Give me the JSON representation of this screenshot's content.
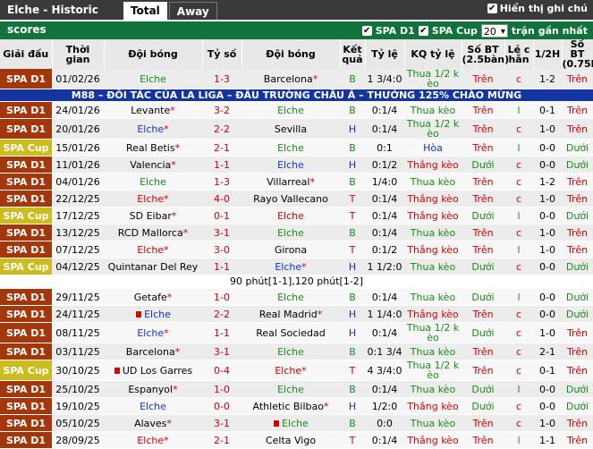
{
  "header": {
    "title": "Elche - Historic scores",
    "tabs": [
      "Total",
      "Away"
    ],
    "show_notes_label": "Hiển thị ghi chú"
  },
  "filters": {
    "spa_d1": "SPA D1",
    "spa_cup": "SPA Cup",
    "count": "20",
    "recent_label": "trận gần nhất"
  },
  "columns": [
    "Giải đấu",
    "Thời gian",
    "Đội bóng",
    "Tỷ số",
    "Đội bóng",
    "Kết quả",
    "Tỷ lệ",
    "KQ tỷ lệ",
    "Số BT (2.5bàn)",
    "Lẻ c hẵn",
    "1/2H",
    "Số BT (0.75bàn)"
  ],
  "ad_text": "M88 – ĐỐI TÁC CỦA LA LIGA – ĐẤU TRƯỜNG CHÂU Á – THƯỞNG 125% CHÀO MỪNG",
  "info_text": "90 phút[1-1],120 phút[1-2]",
  "rows": [
    {
      "league": "SPA D1",
      "date": "01/02/26",
      "home": "Elche",
      "home_star": "",
      "score": "1-3",
      "away": "Barcelona",
      "away_star": "*",
      "res": "B",
      "odds": "1 3/4:0",
      "kq": "Thua 1/2 k èo",
      "kqc": "lose",
      "ou": "Trên",
      "oe": "c",
      "ht": "1-2",
      "ou2": "Trên",
      "hc": "green",
      "ac": "black"
    },
    {
      "league": "SPA D1",
      "date": "24/01/26",
      "home": "Levante",
      "home_star": "*",
      "score": "3-2",
      "away": "Elche",
      "away_star": "",
      "res": "B",
      "odds": "0:1/4",
      "kq": "Thua kèo",
      "kqc": "lose",
      "ou": "Trên",
      "oe": "l",
      "ht": "0-1",
      "ou2": "Trên",
      "hc": "black",
      "ac": "green"
    },
    {
      "league": "SPA D1",
      "date": "20/01/26",
      "home": "Elche",
      "home_star": "*",
      "score": "2-2",
      "away": "Sevilla",
      "away_star": "",
      "res": "H",
      "odds": "0:1/4",
      "kq": "Thua 1/2 k èo",
      "kqc": "lose",
      "ou": "Trên",
      "oe": "c",
      "ht": "1-0",
      "ou2": "Trên",
      "hc": "blue",
      "ac": "black"
    },
    {
      "league": "SPA Cup",
      "date": "15/01/26",
      "home": "Real Betis",
      "home_star": "*",
      "score": "2-1",
      "away": "Elche",
      "away_star": "",
      "res": "B",
      "odds": "0:1",
      "kq": "Hòa",
      "kqc": "draw",
      "ou": "Trên",
      "oe": "l",
      "ht": "0-0",
      "ou2": "Dưới",
      "hc": "black",
      "ac": "green"
    },
    {
      "league": "SPA D1",
      "date": "11/01/26",
      "home": "Valencia",
      "home_star": "*",
      "score": "1-1",
      "away": "Elche",
      "away_star": "",
      "res": "H",
      "odds": "0:1/2",
      "kq": "Thắng kèo",
      "kqc": "win",
      "ou": "Dưới",
      "oe": "c",
      "ht": "0-0",
      "ou2": "Dưới",
      "hc": "black",
      "ac": "blue"
    },
    {
      "league": "SPA D1",
      "date": "04/01/26",
      "home": "Elche",
      "home_star": "",
      "score": "1-3",
      "away": "Villarreal",
      "away_star": "*",
      "res": "B",
      "odds": "1/4:0",
      "kq": "Thua kèo",
      "kqc": "lose",
      "ou": "Trên",
      "oe": "c",
      "ht": "1-2",
      "ou2": "Trên",
      "hc": "green",
      "ac": "black"
    },
    {
      "league": "SPA D1",
      "date": "22/12/25",
      "home": "Elche",
      "home_star": "*",
      "score": "4-0",
      "away": "Rayo Vallecano",
      "away_star": "",
      "res": "T",
      "odds": "0:1/4",
      "kq": "Thắng kèo",
      "kqc": "win",
      "ou": "Trên",
      "oe": "c",
      "ht": "1-0",
      "ou2": "Trên",
      "hc": "red",
      "ac": "black"
    },
    {
      "league": "SPA Cup",
      "date": "17/12/25",
      "home": "SD Eibar",
      "home_star": "*",
      "score": "0-1",
      "away": "Elche",
      "away_star": "",
      "res": "T",
      "odds": "0:1/4",
      "kq": "Thắng kèo",
      "kqc": "win",
      "ou": "Dưới",
      "oe": "l",
      "ht": "0-0",
      "ou2": "Dưới",
      "hc": "black",
      "ac": "red"
    },
    {
      "league": "SPA D1",
      "date": "13/12/25",
      "home": "RCD Mallorca",
      "home_star": "*",
      "score": "3-1",
      "away": "Elche",
      "away_star": "",
      "res": "B",
      "odds": "0:1/4",
      "kq": "Thua kèo",
      "kqc": "lose",
      "ou": "Trên",
      "oe": "c",
      "ht": "1-0",
      "ou2": "Trên",
      "hc": "black",
      "ac": "green"
    },
    {
      "league": "SPA D1",
      "date": "07/12/25",
      "home": "Elche",
      "home_star": "*",
      "score": "3-0",
      "away": "Girona",
      "away_star": "",
      "res": "T",
      "odds": "0:1/2",
      "kq": "Thắng kèo",
      "kqc": "win",
      "ou": "Trên",
      "oe": "l",
      "ht": "1-0",
      "ou2": "Trên",
      "hc": "red",
      "ac": "black"
    },
    {
      "league": "SPA Cup",
      "date": "04/12/25",
      "home": "Quintanar Del Rey",
      "home_star": "",
      "score": "1-1",
      "away": "Elche",
      "away_star": "*",
      "res": "H",
      "odds": "1 1/2:0",
      "kq": "Thua kèo",
      "kqc": "lose",
      "ou": "Dưới",
      "oe": "c",
      "ht": "0-0",
      "ou2": "Dưới",
      "hc": "black",
      "ac": "blue",
      "info": true
    },
    {
      "league": "SPA D1",
      "date": "29/11/25",
      "home": "Getafe",
      "home_star": "*",
      "score": "1-0",
      "away": "Elche",
      "away_star": "",
      "res": "B",
      "odds": "0:1/4",
      "kq": "Thua kèo",
      "kqc": "lose",
      "ou": "Dưới",
      "oe": "l",
      "ht": "0-0",
      "ou2": "Dưới",
      "hc": "black",
      "ac": "green"
    },
    {
      "league": "SPA D1",
      "date": "24/11/25",
      "home": "Elche",
      "home_star": "",
      "score": "2-2",
      "away": "Real Madrid",
      "away_star": "*",
      "res": "H",
      "odds": "1 1/4:0",
      "kq": "Thắng kèo",
      "kqc": "win",
      "ou": "Trên",
      "oe": "c",
      "ht": "0-0",
      "ou2": "Dưới",
      "hc": "blue",
      "ac": "black",
      "hflag": true
    },
    {
      "league": "SPA D1",
      "date": "08/11/25",
      "home": "Elche",
      "home_star": "*",
      "score": "1-1",
      "away": "Real Sociedad",
      "away_star": "",
      "res": "H",
      "odds": "0:1/4",
      "kq": "Thua 1/2 k èo",
      "kqc": "lose",
      "ou": "Dưới",
      "oe": "c",
      "ht": "1-0",
      "ou2": "Trên",
      "hc": "blue",
      "ac": "black"
    },
    {
      "league": "SPA D1",
      "date": "03/11/25",
      "home": "Barcelona",
      "home_star": "*",
      "score": "3-1",
      "away": "Elche",
      "away_star": "",
      "res": "B",
      "odds": "0:1 3/4",
      "kq": "Thua kèo",
      "kqc": "lose",
      "ou": "Trên",
      "oe": "c",
      "ht": "2-1",
      "ou2": "Trên",
      "hc": "black",
      "ac": "green"
    },
    {
      "league": "SPA Cup",
      "date": "30/10/25",
      "home": "UD Los Garres",
      "home_star": "",
      "score": "0-4",
      "away": "Elche",
      "away_star": "*",
      "res": "T",
      "odds": "4 3/4:0",
      "kq": "Thua 1/2 k èo",
      "kqc": "lose",
      "ou": "Trên",
      "oe": "c",
      "ht": "0-1",
      "ou2": "Trên",
      "hc": "black",
      "ac": "red",
      "hflag": true
    },
    {
      "league": "SPA D1",
      "date": "25/10/25",
      "home": "Espanyol",
      "home_star": "*",
      "score": "1-0",
      "away": "Elche",
      "away_star": "",
      "res": "B",
      "odds": "0:1/4",
      "kq": "Thua kèo",
      "kqc": "lose",
      "ou": "Dưới",
      "oe": "l",
      "ht": "0-0",
      "ou2": "Dưới",
      "hc": "black",
      "ac": "green"
    },
    {
      "league": "SPA D1",
      "date": "19/10/25",
      "home": "Elche",
      "home_star": "",
      "score": "0-0",
      "away": "Athletic Bilbao",
      "away_star": "*",
      "res": "H",
      "odds": "1/2:0",
      "kq": "Thắng kèo",
      "kqc": "win",
      "ou": "Dưới",
      "oe": "c",
      "ht": "0-0",
      "ou2": "Dưới",
      "hc": "blue",
      "ac": "black"
    },
    {
      "league": "SPA D1",
      "date": "05/10/25",
      "home": "Alaves",
      "home_star": "*",
      "score": "3-1",
      "away": "Elche",
      "away_star": "",
      "res": "B",
      "odds": "0:0",
      "kq": "Thua kèo",
      "kqc": "lose",
      "ou": "Trên",
      "oe": "c",
      "ht": "1-0",
      "ou2": "Trên",
      "hc": "black",
      "ac": "green",
      "aflag": true
    },
    {
      "league": "SPA D1",
      "date": "28/09/25",
      "home": "Elche",
      "home_star": "*",
      "score": "2-1",
      "away": "Celta Vigo",
      "away_star": "",
      "res": "T",
      "odds": "0:1/4",
      "kq": "Thắng kèo",
      "kqc": "win",
      "ou": "Trên",
      "oe": "l",
      "ht": "1-1",
      "ou2": "Trên",
      "hc": "red",
      "ac": "black"
    }
  ]
}
